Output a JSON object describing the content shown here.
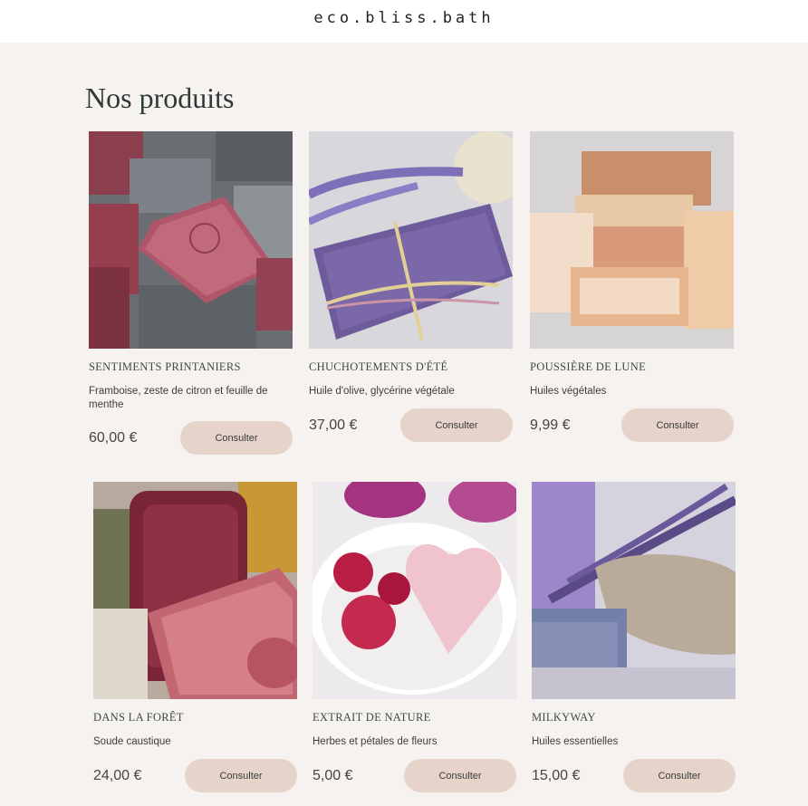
{
  "header": {
    "logo": "eco.bliss.bath"
  },
  "page": {
    "title": "Nos produits"
  },
  "products": [
    {
      "name": "Sentiments printaniers",
      "description": "Framboise, zeste de citron et feuille de menthe",
      "price": "60,00 €",
      "button": "Consulter"
    },
    {
      "name": "Chuchotements d'été",
      "description": "Huile d'olive, glycérine végétale",
      "price": "37,00 €",
      "button": "Consulter"
    },
    {
      "name": "Poussière de lune",
      "description": "Huiles végétales",
      "price": "9,99 €",
      "button": "Consulter"
    },
    {
      "name": "Dans la forêt",
      "description": "Soude caustique",
      "price": "24,00 €",
      "button": "Consulter"
    },
    {
      "name": "Extrait de nature",
      "description": "Herbes et pétales de fleurs",
      "price": "5,00 €",
      "button": "Consulter"
    },
    {
      "name": "Milkyway",
      "description": "Huiles essentielles",
      "price": "15,00 €",
      "button": "Consulter"
    }
  ]
}
